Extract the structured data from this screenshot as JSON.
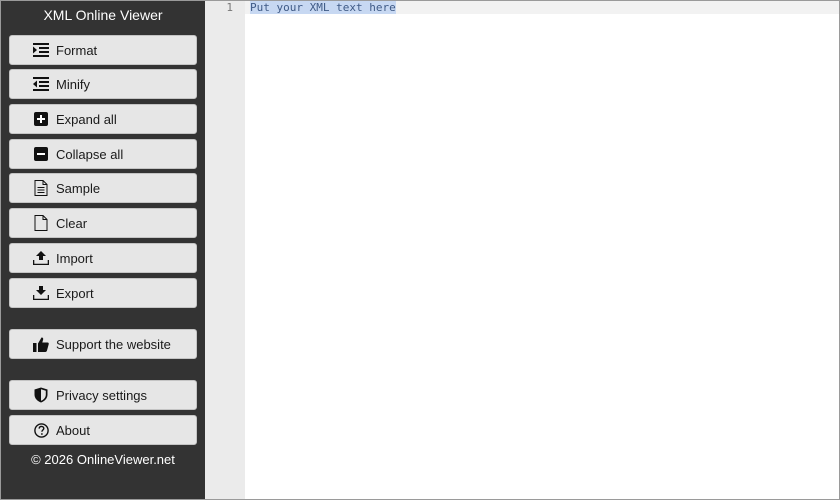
{
  "app": {
    "title": "XML Online Viewer",
    "copyright": "© 2026 OnlineViewer.net"
  },
  "toolbar": {
    "format_label": "Format",
    "minify_label": "Minify",
    "expand_all_label": "Expand all",
    "collapse_all_label": "Collapse all",
    "sample_label": "Sample",
    "clear_label": "Clear",
    "import_label": "Import",
    "export_label": "Export",
    "support_label": "Support the website",
    "privacy_label": "Privacy settings",
    "about_label": "About"
  },
  "icons": {
    "format": "format-indent-icon",
    "minify": "minify-icon",
    "expand_all": "plus-square-icon",
    "collapse_all": "minus-square-icon",
    "sample": "document-lines-icon",
    "clear": "blank-document-icon",
    "import": "upload-icon",
    "export": "download-icon",
    "support": "thumbs-up-icon",
    "privacy": "shield-icon",
    "about": "question-circle-icon"
  },
  "editor": {
    "line_number": "1",
    "placeholder": "Put your XML text here"
  },
  "colors": {
    "sidebar_bg": "#333333",
    "button_bg": "#e6e6e6",
    "gutter_bg": "#ebebeb",
    "selection_bg": "#c7d8f2"
  }
}
